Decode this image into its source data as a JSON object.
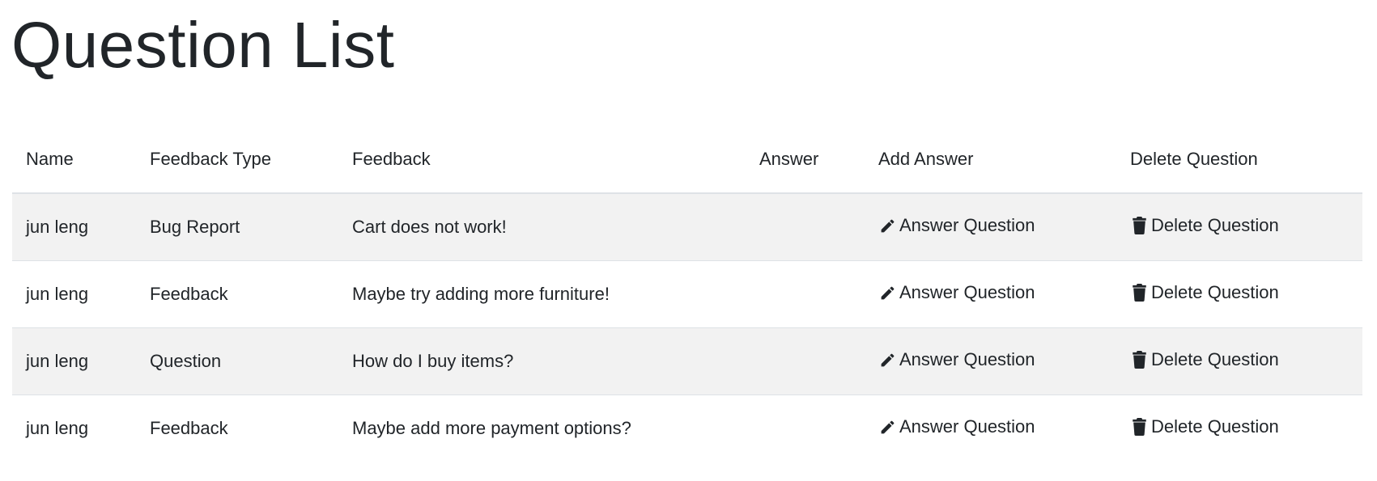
{
  "page": {
    "title": "Question List"
  },
  "table": {
    "headers": [
      "Name",
      "Feedback Type",
      "Feedback",
      "Answer",
      "Add Answer",
      "Delete Question"
    ],
    "rows": [
      {
        "name": "jun leng",
        "feedback_type": "Bug Report",
        "feedback": "Cart does not work!",
        "answer": "",
        "add_answer_label": "Answer Question",
        "delete_label": "Delete Question"
      },
      {
        "name": "jun leng",
        "feedback_type": "Feedback",
        "feedback": "Maybe try adding more furniture!",
        "answer": "",
        "add_answer_label": "Answer Question",
        "delete_label": "Delete Question"
      },
      {
        "name": "jun leng",
        "feedback_type": "Question",
        "feedback": "How do I buy items?",
        "answer": "",
        "add_answer_label": "Answer Question",
        "delete_label": "Delete Question"
      },
      {
        "name": "jun leng",
        "feedback_type": "Feedback",
        "feedback": "Maybe add more payment options?",
        "answer": "",
        "add_answer_label": "Answer Question",
        "delete_label": "Delete Question"
      }
    ]
  },
  "icons": {
    "answer": "pencil-icon",
    "delete": "trash-icon"
  },
  "colors": {
    "text": "#212529",
    "row_stripe": "#f2f2f2",
    "border": "#dee2e6"
  }
}
